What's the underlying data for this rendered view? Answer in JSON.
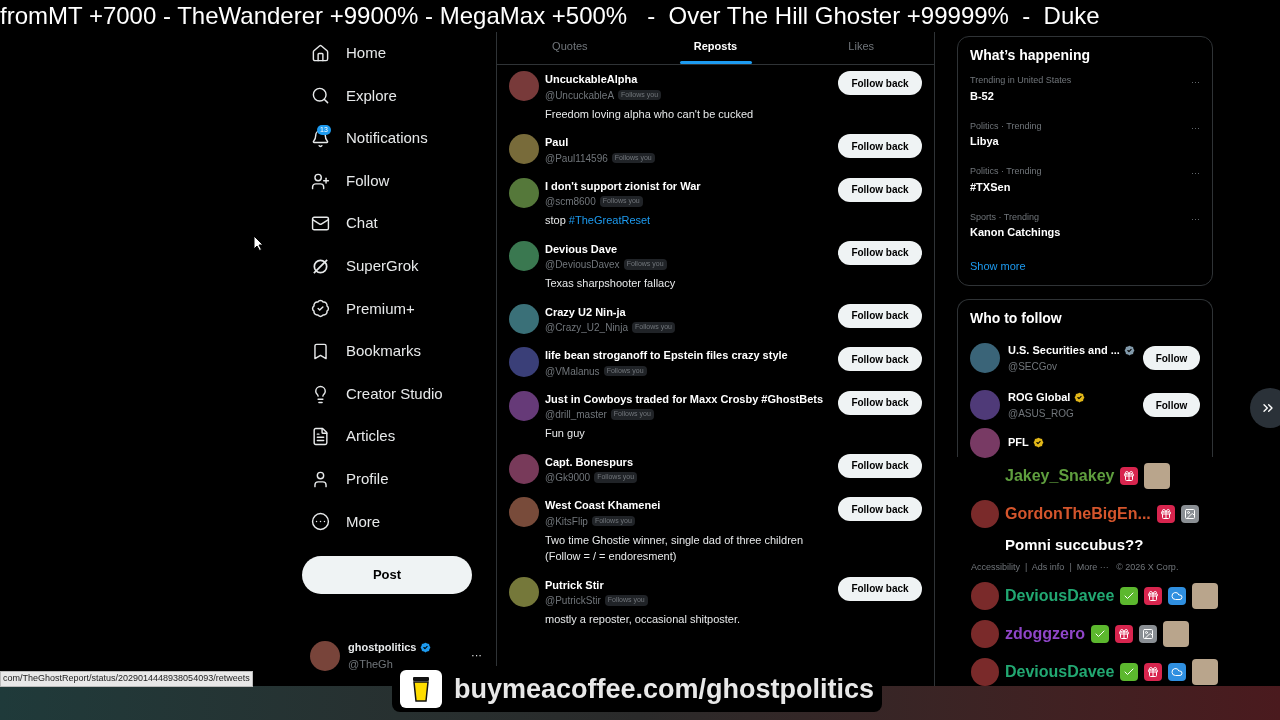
{
  "ticker": "fromMT +7000 - TheWanderer +9900% - MegaMax +500%   -  Over The Hill Ghoster +99999%  -  Duke",
  "nav": {
    "items": [
      {
        "label": "Home"
      },
      {
        "label": "Explore"
      },
      {
        "label": "Notifications",
        "badge": "13"
      },
      {
        "label": "Follow"
      },
      {
        "label": "Chat"
      },
      {
        "label": "SuperGrok"
      },
      {
        "label": "Premium+"
      },
      {
        "label": "Bookmarks"
      },
      {
        "label": "Creator Studio"
      },
      {
        "label": "Articles"
      },
      {
        "label": "Profile"
      },
      {
        "label": "More"
      }
    ],
    "post_button": "Post",
    "account": {
      "name": "ghostpolitics",
      "verified": true,
      "handle": "@TheGh",
      "menu": "···"
    }
  },
  "feed": {
    "tabs": [
      {
        "label": "Quotes",
        "selected": false
      },
      {
        "label": "Reposts",
        "selected": true
      },
      {
        "label": "Likes",
        "selected": false
      }
    ],
    "rows": [
      {
        "name": "UncuckableAlpha",
        "handle": "@UncuckableA",
        "follows_label": "Follows you",
        "bio": "Freedom loving alpha who can't be cucked",
        "button": "Follow back"
      },
      {
        "name": "Paul",
        "handle": "@Paul114596",
        "follows_label": "Follows you",
        "button": "Follow back"
      },
      {
        "name": "I don't support zionist for War",
        "handle": "@scm8600",
        "follows_label": "Follows you",
        "bio": "stop",
        "bio_link": "#TheGreatReset",
        "button": "Follow back"
      },
      {
        "name": "Devious Dave",
        "handle": "@DeviousDavex",
        "follows_label": "Follows you",
        "bio": "Texas sharpshooter fallacy",
        "button": "Follow back"
      },
      {
        "name": "Crazy U2 Nin-ja",
        "handle": "@Crazy_U2_Ninja",
        "follows_label": "Follows you",
        "button": "Follow back"
      },
      {
        "name": "life bean stroganoff to Epstein files crazy style",
        "handle": "@VMalanus",
        "follows_label": "Follows you",
        "button": "Follow back"
      },
      {
        "name": "Just in Cowboys traded for Maxx Crosby #GhostBets",
        "handle": "@drill_master",
        "follows_label": "Follows you",
        "bio": "Fun guy",
        "button": "Follow back"
      },
      {
        "name": "Capt. Bonespurs",
        "handle": "@Gk9000",
        "follows_label": "Follows you",
        "button": "Follow back"
      },
      {
        "name": "West Coast Khamenei",
        "handle": "@KitsFlip",
        "follows_label": "Follows you",
        "bio": "Two time Ghostie winner, single dad of three children (Follow = / = endoresment)",
        "button": "Follow back"
      },
      {
        "name": "Putrick Stir",
        "handle": "@PutrickStir",
        "follows_label": "Follows you",
        "bio": "mostly a reposter, occasional shitposter.",
        "button": "Follow back"
      }
    ]
  },
  "trends": {
    "title": "What’s happening",
    "items": [
      {
        "context": "Trending in United States",
        "topic": "B-52"
      },
      {
        "context": "Politics · Trending",
        "topic": "Libya"
      },
      {
        "context": "Politics · Trending",
        "topic": "#TXSen"
      },
      {
        "context": "Sports · Trending",
        "topic": "Kanon Catchings"
      }
    ],
    "more_icon": "···",
    "show_more": "Show more"
  },
  "who_to_follow": {
    "title": "Who to follow",
    "items": [
      {
        "name": "U.S. Securities and ...",
        "verified": true,
        "color": "#829aab",
        "handle": "@SECGov",
        "button": "Follow"
      },
      {
        "name": "ROG Global",
        "verified": true,
        "color": "#e2b719",
        "handle": "@ASUS_ROG",
        "button": "Follow"
      },
      {
        "name": "PFL",
        "verified": true,
        "color": "#e2b719"
      }
    ]
  },
  "chat": [
    {
      "kind": "user",
      "name": "Jakey_Snakey",
      "color": "#5f9e3e",
      "avatar": false,
      "badges": [
        {
          "kind": "gift"
        }
      ],
      "emote": true
    },
    {
      "kind": "user",
      "name": "GordonTheBigEn...",
      "color": "#d4552c",
      "avatar": true,
      "badges": [
        {
          "kind": "gift"
        },
        {
          "kind": "image"
        }
      ],
      "emote": false
    },
    {
      "kind": "message",
      "text": "Pomni succubus??"
    },
    {
      "kind": "footer",
      "text": "Accessibility  |  Ads info  |  More ···   © 2026 X Corp."
    },
    {
      "kind": "user",
      "name": "DeviousDavee",
      "color": "#22a872",
      "avatar": true,
      "badges": [
        {
          "kind": "check"
        },
        {
          "kind": "gift"
        },
        {
          "kind": "cloud"
        }
      ],
      "emote": true
    },
    {
      "kind": "user",
      "name": "zdoggzero",
      "color": "#8f45c8",
      "avatar": true,
      "badges": [
        {
          "kind": "check"
        },
        {
          "kind": "gift"
        },
        {
          "kind": "image"
        }
      ],
      "emote": true
    },
    {
      "kind": "user",
      "name": "DeviousDavee",
      "color": "#22a872",
      "avatar": true,
      "badges": [
        {
          "kind": "check"
        },
        {
          "kind": "gift"
        },
        {
          "kind": "cloud"
        }
      ],
      "emote": true
    }
  ],
  "status_url": "com/TheGhostReport/status/2029014448938054093/retweets",
  "banner": "buymeacoffee.com/ghostpolitics"
}
